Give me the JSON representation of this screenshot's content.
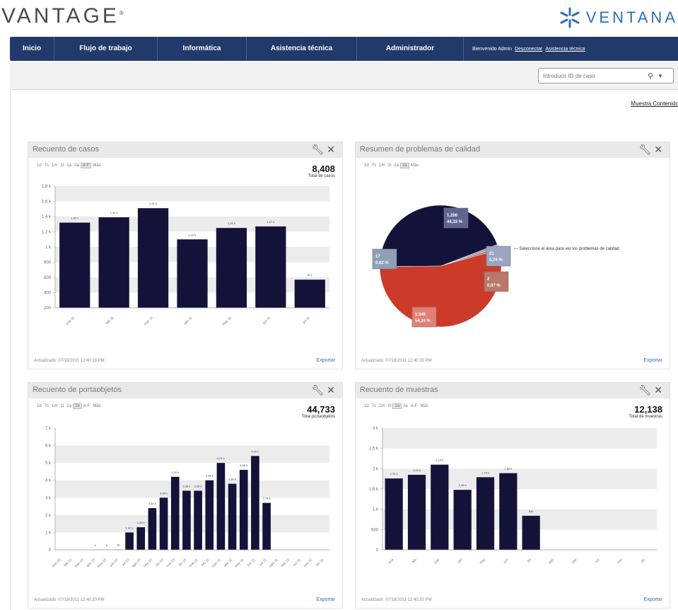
{
  "brand": {
    "left_logo": "VANTAGE",
    "right_logo": "VENTANA",
    "trademark": "®"
  },
  "nav": {
    "items": [
      "Inicio",
      "Flujo de trabajo",
      "Informática",
      "Asistencia técnica",
      "Administrador"
    ],
    "user": "Bienvenido Admin",
    "logout": "Desconectar",
    "help": "Asistencia técnica"
  },
  "search": {
    "placeholder": "Introducir ID de caso"
  },
  "content": {
    "show_link": "Muestra Contenido"
  },
  "panels": {
    "cases": {
      "title": "Recuento de casos",
      "ranges": [
        "1d",
        "7s",
        "1m",
        "1t",
        "1a",
        "2a",
        "A-F",
        "Más"
      ],
      "selected": "A-F",
      "total": "8,408",
      "total_label": "Total de casos",
      "updated": "Actualizado: 07/18/2011 12:40:18 PM",
      "export": "Exportar"
    },
    "quality": {
      "title": "Resumen de problemas de calidad",
      "ranges": [
        "1d",
        "7s",
        "1m",
        "1t",
        "1a",
        "2a",
        "Más"
      ],
      "selected": "2a",
      "legend": "— Seleccione el área para ver los problemas de calidad",
      "updated": "Actualizado: 07/18/2011 12:40:20 PM",
      "export": "Exportar"
    },
    "slides": {
      "title": "Recuento de portaobjetos",
      "ranges": [
        "1d",
        "7s",
        "1m",
        "1t",
        "1a",
        "2a",
        "A-F",
        "Más"
      ],
      "selected": "2a",
      "total": "44,733",
      "total_label": "Total portaobjetos",
      "updated": "Actualizado: 07/18/2011 12:40:20 PM",
      "export": "Exportar"
    },
    "samples": {
      "title": "Recuento de muestras",
      "ranges": [
        "1d",
        "7s",
        "1m",
        "1t",
        "1a",
        "2a",
        "A-F",
        "Más"
      ],
      "selected": "1a",
      "total": "12,138",
      "total_label": "Total de muestras",
      "updated": "Actualizado: 07/18/2011 12:40:20 PM",
      "export": "Exportar"
    }
  },
  "colors": {
    "nav": "#213a6a",
    "bar": "#13133a",
    "pie_dark": "#13133a",
    "pie_red": "#cc3b2a",
    "link": "#2b6fb6"
  },
  "chart_data": [
    {
      "type": "bar",
      "title": "Recuento de casos",
      "categories": [
        "ene-11",
        "feb-11",
        "mar-11",
        "abr-11",
        "may-11",
        "jun-11",
        "jul-11"
      ],
      "values": [
        1320,
        1390,
        1510,
        1100,
        1250,
        1270,
        570
      ],
      "labels": [
        "1,32 k",
        "1,39 k",
        "1,51 k",
        "1,10 k",
        "1,25 k",
        "1,27 k",
        "577"
      ],
      "yticks": [
        "200",
        "400",
        "600",
        "800",
        "1 k",
        "1,2 k",
        "1,4 k",
        "1,6 k",
        "1,8 k"
      ],
      "ylim": [
        200,
        1800
      ]
    },
    {
      "type": "pie",
      "title": "Resumen de problemas de calidad",
      "slices": [
        {
          "label": "1.206",
          "pct": "44,33 %",
          "value": 44.33,
          "color": "#13133a"
        },
        {
          "label": "1.546",
          "pct": "54,24 %",
          "value": 54.24,
          "color": "#cc3b2a"
        },
        {
          "label": "21",
          "pct": "0,74 %",
          "value": 0.74,
          "color": "#9aa6c2"
        },
        {
          "label": "2",
          "pct": "0,07 %",
          "value": 0.07,
          "color": "#b9786a"
        },
        {
          "label": "17",
          "pct": "0,62 %",
          "value": 0.62,
          "color": "#8ea0b8"
        }
      ]
    },
    {
      "type": "bar",
      "title": "Recuento de portaobjetos",
      "categories": [
        "ene-10",
        "feb-10",
        "mar-10",
        "abr-10",
        "may-10",
        "jun-10",
        "jul-10",
        "ago-10",
        "sep-10",
        "oct-10",
        "nov-10",
        "dic-10",
        "ene-11",
        "feb-11",
        "mar-11",
        "abr-11",
        "may-11",
        "jun-11",
        "jul-11",
        "ago-11",
        "sep-11",
        "oct-11",
        "nov-11",
        "dic-11"
      ],
      "values": [
        0,
        0,
        0,
        4,
        5,
        16,
        1000,
        1300,
        2400,
        3000,
        4200,
        3400,
        3400,
        4000,
        5000,
        3800,
        4600,
        5400,
        2700,
        0,
        0,
        0,
        0,
        0
      ],
      "labels": [
        "",
        "",
        "",
        "4",
        "5",
        "16",
        "1,00 k",
        "1,35 k",
        "2,40 k",
        "3,04 k",
        "4,20 k",
        "3,36 k",
        "3,35 k",
        "3,98 k",
        "5,01 k",
        "3,84 k",
        "4,66 k",
        "5,40 k",
        "2,74 k",
        "",
        "",
        "",
        "",
        ""
      ],
      "yticks": [
        "0",
        "1 k",
        "2 k",
        "3 k",
        "4 k",
        "5 k",
        "6 k",
        "7 k"
      ],
      "ylim": [
        0,
        7000
      ]
    },
    {
      "type": "bar",
      "title": "Recuento de muestras",
      "categories": [
        "ene",
        "feb",
        "mar",
        "abr",
        "may",
        "jun",
        "jul",
        "ago",
        "sep",
        "oct",
        "nov",
        "dic"
      ],
      "values": [
        1760,
        1850,
        2100,
        1480,
        1790,
        1890,
        840,
        0,
        0,
        0,
        0,
        0
      ],
      "labels": [
        "1,76 k",
        "1,85 k",
        "2,10 k",
        "1,48 k",
        "1,79 k",
        "1,89 k",
        "840",
        "",
        "",
        "",
        "",
        ""
      ],
      "yticks": [
        "0",
        "500",
        "1 k",
        "1,5 k",
        "2 k",
        "2,5 k",
        "3 k"
      ],
      "ylim": [
        0,
        3000
      ]
    }
  ]
}
